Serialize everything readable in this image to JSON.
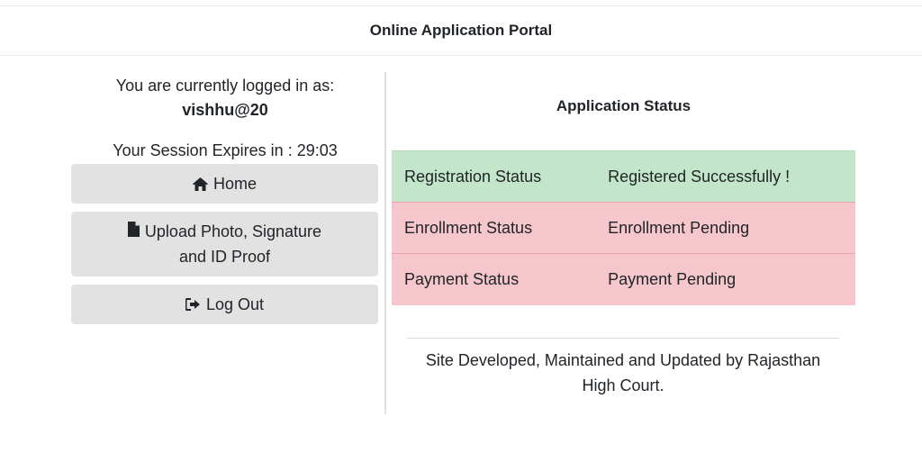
{
  "header": {
    "title": "Online Application Portal"
  },
  "sidebar": {
    "logged_in_label": "You are currently logged in as:",
    "username": "vishhu@20",
    "session_label": "Your Session Expires in : 29:03",
    "buttons": {
      "home": {
        "label": "Home",
        "icon": "home-icon"
      },
      "upload": {
        "line1": "Upload Photo, Signature",
        "line2": "and ID Proof",
        "icon": "file-icon"
      },
      "logout": {
        "label": "Log Out",
        "icon": "logout-icon"
      }
    }
  },
  "main": {
    "heading": "Application Status",
    "rows": [
      {
        "label": "Registration Status",
        "value": "Registered Successfully !",
        "state": "success"
      },
      {
        "label": "Enrollment Status",
        "value": "Enrollment Pending",
        "state": "danger"
      },
      {
        "label": "Payment Status",
        "value": "Payment Pending",
        "state": "danger"
      }
    ],
    "footer": {
      "line1": "Site Developed, Maintained and Updated by Rajasthan",
      "line2": "High Court."
    }
  },
  "colors": {
    "success_bg": "#c3e6cb",
    "danger_bg": "#f5c6cb",
    "button_bg": "#e2e2e2"
  }
}
